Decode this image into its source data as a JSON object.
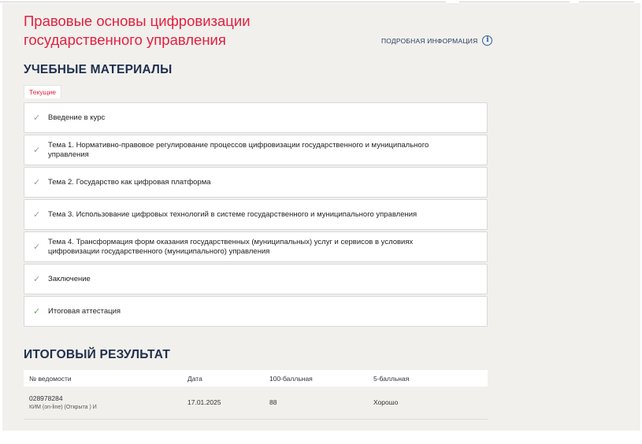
{
  "course": {
    "title": "Правовые основы цифровизации государственного управления",
    "more_info_label": "ПОДРОБНАЯ ИНФОРМАЦИЯ"
  },
  "materials": {
    "heading": "УЧЕБНЫЕ МАТЕРИАЛЫ",
    "current_tab": "Текущие",
    "items": [
      {
        "label": "Введение в курс",
        "status": "viewed"
      },
      {
        "label": "Тема 1. Нормативно-правовое регулирование процессов цифровизации государственного и муниципального управления",
        "status": "viewed"
      },
      {
        "label": "Тема 2. Государство как цифровая платформа",
        "status": "viewed"
      },
      {
        "label": "Тема 3. Использование цифровых технологий в системе государственного и муниципального управления",
        "status": "viewed"
      },
      {
        "label": "Тема 4. Трансформация форм оказания государственных (муниципальных) услуг и сервисов в условиях цифровизации государственного (муниципального) управления",
        "status": "viewed"
      },
      {
        "label": "Заключение",
        "status": "viewed"
      },
      {
        "label": "Итоговая аттестация",
        "status": "completed"
      }
    ]
  },
  "result": {
    "heading": "ИТОГОВЫЙ РЕЗУЛЬТАТ",
    "columns": [
      "№ ведомости",
      "Дата",
      "100-балльная",
      "5-балльная"
    ],
    "rows": [
      {
        "number": "028978284",
        "subtitle": "КИМ (on-line) (Открыта ) И",
        "date": "17.01.2025",
        "score100": "88",
        "score5": "Хорошо"
      }
    ]
  },
  "colors": {
    "accent": "#e3203e",
    "heading": "#1f2f4d",
    "check_done": "#6aa84f",
    "check_viewed": "#9a9a9a",
    "page_bg": "#f1f0ed"
  },
  "icons": {
    "info": "info-circle-icon",
    "check": "check-icon"
  }
}
